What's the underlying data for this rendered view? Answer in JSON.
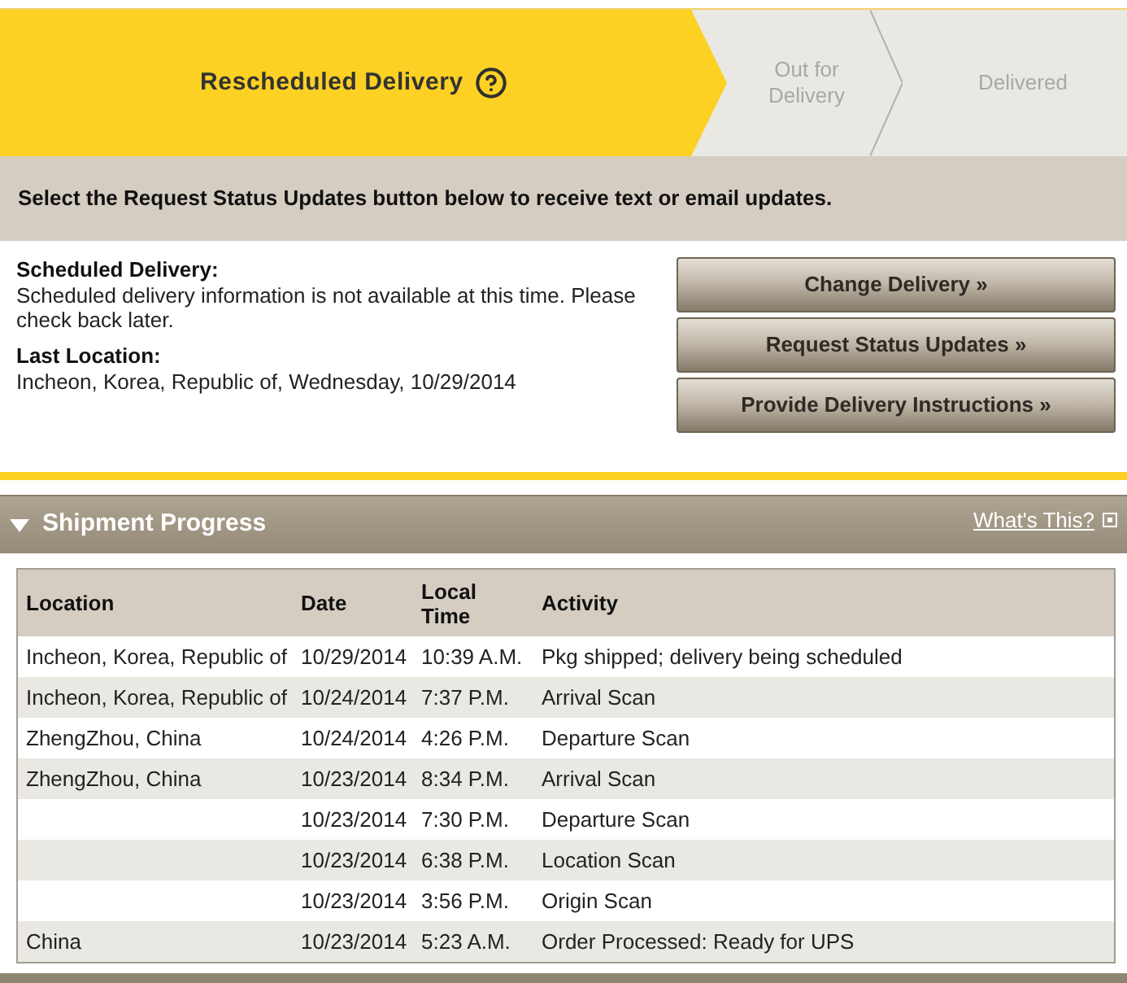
{
  "progress_steps": [
    {
      "label": "Rescheduled Delivery",
      "selected": true,
      "help": true
    },
    {
      "label": "Out for Delivery",
      "selected": false,
      "help": false
    },
    {
      "label": "Delivered",
      "selected": false,
      "help": false
    }
  ],
  "notice": "Select the Request Status Updates button below to receive text or email updates.",
  "delivery_details": [
    {
      "label": "Scheduled Delivery:",
      "value": "Scheduled delivery information is not available at this time. Please check back later."
    },
    {
      "label": "Last Location:",
      "value": "Incheon, Korea, Republic of, Wednesday, 10/29/2014"
    }
  ],
  "action_buttons": [
    "Change Delivery »",
    "Request Status Updates »",
    "Provide Delivery Instructions »"
  ],
  "shipment_progress": {
    "title": "Shipment Progress",
    "expanded": true,
    "help_link": "What's This?",
    "table": {
      "columns": [
        "Location",
        "Date",
        "Local Time",
        "Activity"
      ],
      "rows": [
        {
          "location": "Incheon, Korea, Republic of",
          "date": "10/29/2014",
          "local_time": "10:39 A.M.",
          "activity": "Pkg shipped; delivery being scheduled"
        },
        {
          "location": "Incheon, Korea, Republic of",
          "date": "10/24/2014",
          "local_time": "7:37 P.M.",
          "activity": "Arrival Scan"
        },
        {
          "location": "ZhengZhou, China",
          "date": "10/24/2014",
          "local_time": "4:26 P.M.",
          "activity": "Departure Scan"
        },
        {
          "location": "ZhengZhou, China",
          "date": "10/23/2014",
          "local_time": "8:34 P.M.",
          "activity": "Arrival Scan"
        },
        {
          "date": "10/23/2014",
          "local_time": "7:30 P.M.",
          "activity": "Departure Scan"
        },
        {
          "date": "10/23/2014",
          "local_time": "6:38 P.M.",
          "activity": "Location Scan"
        },
        {
          "date": "10/23/2014",
          "local_time": "3:56 P.M.",
          "activity": "Origin Scan"
        },
        {
          "location": "China",
          "date": "10/23/2014",
          "local_time": "5:23 A.M.",
          "activity": "Order Processed: Ready for UPS"
        }
      ]
    }
  }
}
